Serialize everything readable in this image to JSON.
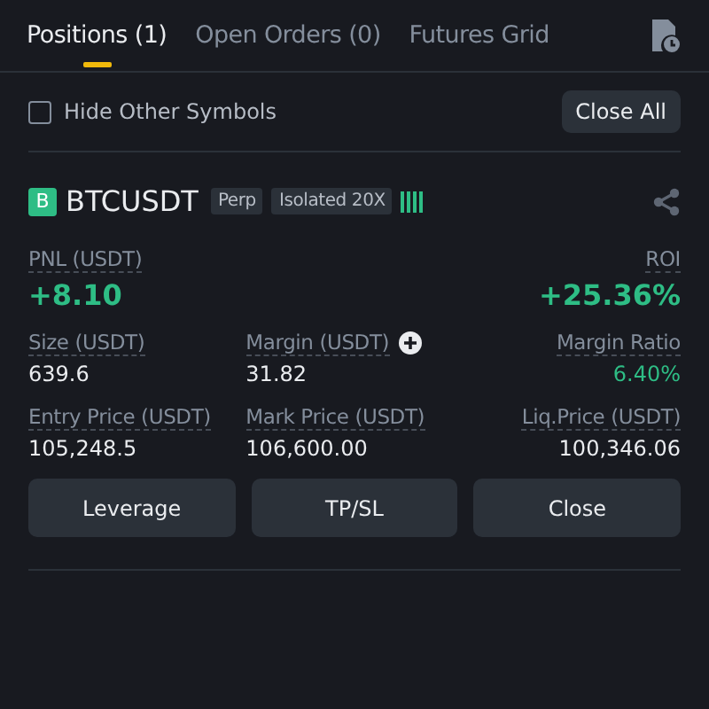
{
  "tabs": [
    {
      "label": "Positions (1)",
      "selected": true
    },
    {
      "label": "Open Orders (0)",
      "selected": false
    },
    {
      "label": "Futures Grid",
      "selected": false
    }
  ],
  "filter": {
    "label": "Hide Other Symbols",
    "checked": false
  },
  "close_all": "Close All",
  "position": {
    "side": "B",
    "symbol": "BTCUSDT",
    "tags": [
      "Perp",
      "Isolated 20X"
    ],
    "stats": [
      {
        "kind": "headline",
        "label": "PNL (USDT)",
        "value": "+8.10",
        "positive": true,
        "addable": false
      },
      {
        "kind": "headline",
        "label": "ROI",
        "value": "+25.36%",
        "positive": true,
        "addable": false
      },
      {
        "kind": "detail",
        "label": "Size (USDT)",
        "value": "639.6",
        "positive": false,
        "addable": false
      },
      {
        "kind": "detail",
        "label": "Margin (USDT)",
        "value": "31.82",
        "positive": false,
        "addable": true
      },
      {
        "kind": "detail",
        "label": "Margin Ratio",
        "value": "6.40%",
        "positive": true,
        "addable": false
      },
      {
        "kind": "detail",
        "label": "Entry Price (USDT)",
        "value": "105,248.5",
        "positive": false,
        "addable": false
      },
      {
        "kind": "detail",
        "label": "Mark Price (USDT)",
        "value": "106,600.00",
        "positive": false,
        "addable": false
      },
      {
        "kind": "detail",
        "label": "Liq.Price (USDT)",
        "value": "100,346.06",
        "positive": false,
        "addable": false
      }
    ],
    "actions": [
      "Leverage",
      "TP/SL",
      "Close"
    ]
  }
}
